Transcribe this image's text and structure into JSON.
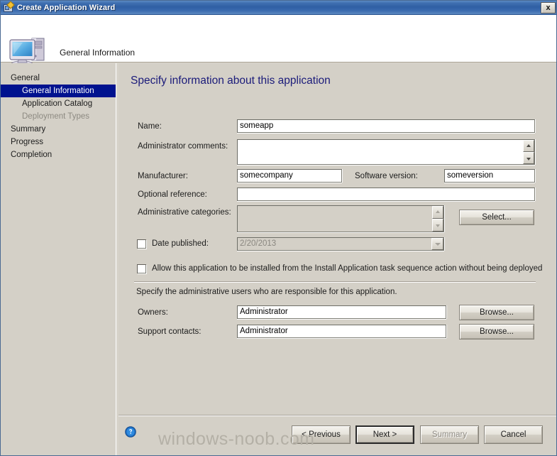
{
  "window": {
    "title": "Create Application Wizard",
    "close_label": "x",
    "title_icon": "wizard-app-icon"
  },
  "header": {
    "title": "General Information",
    "icon": "computer-icon"
  },
  "sidebar": {
    "items": [
      {
        "label": "General",
        "level": 0,
        "state": "normal"
      },
      {
        "label": "General Information",
        "level": 1,
        "state": "selected"
      },
      {
        "label": "Application Catalog",
        "level": 1,
        "state": "normal"
      },
      {
        "label": "Deployment Types",
        "level": 1,
        "state": "disabled"
      },
      {
        "label": "Summary",
        "level": 0,
        "state": "normal"
      },
      {
        "label": "Progress",
        "level": 0,
        "state": "normal"
      },
      {
        "label": "Completion",
        "level": 0,
        "state": "normal"
      }
    ]
  },
  "main": {
    "page_title": "Specify information about this application",
    "fields": {
      "name_label": "Name:",
      "name_value": "someapp",
      "comments_label": "Administrator comments:",
      "comments_value": "",
      "manufacturer_label": "Manufacturer:",
      "manufacturer_value": "somecompany",
      "software_version_label": "Software version:",
      "software_version_value": "someversion",
      "optional_reference_label": "Optional reference:",
      "optional_reference_value": "",
      "admin_categories_label": "Administrative categories:",
      "admin_categories_value": "",
      "select_button": "Select...",
      "date_published_label": "Date published:",
      "date_published_value": "2/20/2013",
      "date_published_checked": false,
      "allow_install_label": "Allow this application to be installed from the Install Application task sequence action without being deployed",
      "allow_install_checked": false,
      "admin_users_hint": "Specify the administrative users who are responsible for this application.",
      "owners_label": "Owners:",
      "owners_value": "Administrator",
      "owners_browse": "Browse...",
      "support_contacts_label": "Support contacts:",
      "support_contacts_value": "Administrator",
      "support_browse": "Browse..."
    }
  },
  "footer": {
    "help_icon": "help-circle-icon",
    "buttons": {
      "previous": "< Previous",
      "next": "Next >",
      "summary": "Summary",
      "cancel": "Cancel"
    }
  },
  "watermark": "windows-noob.com",
  "colors": {
    "titlebar_blue": "#2f5fa4",
    "selection_blue": "#00128f",
    "page_title_color": "#1b1b7a",
    "panel_bg": "#d4d0c7",
    "watermark_color": "#b4b0a6"
  }
}
